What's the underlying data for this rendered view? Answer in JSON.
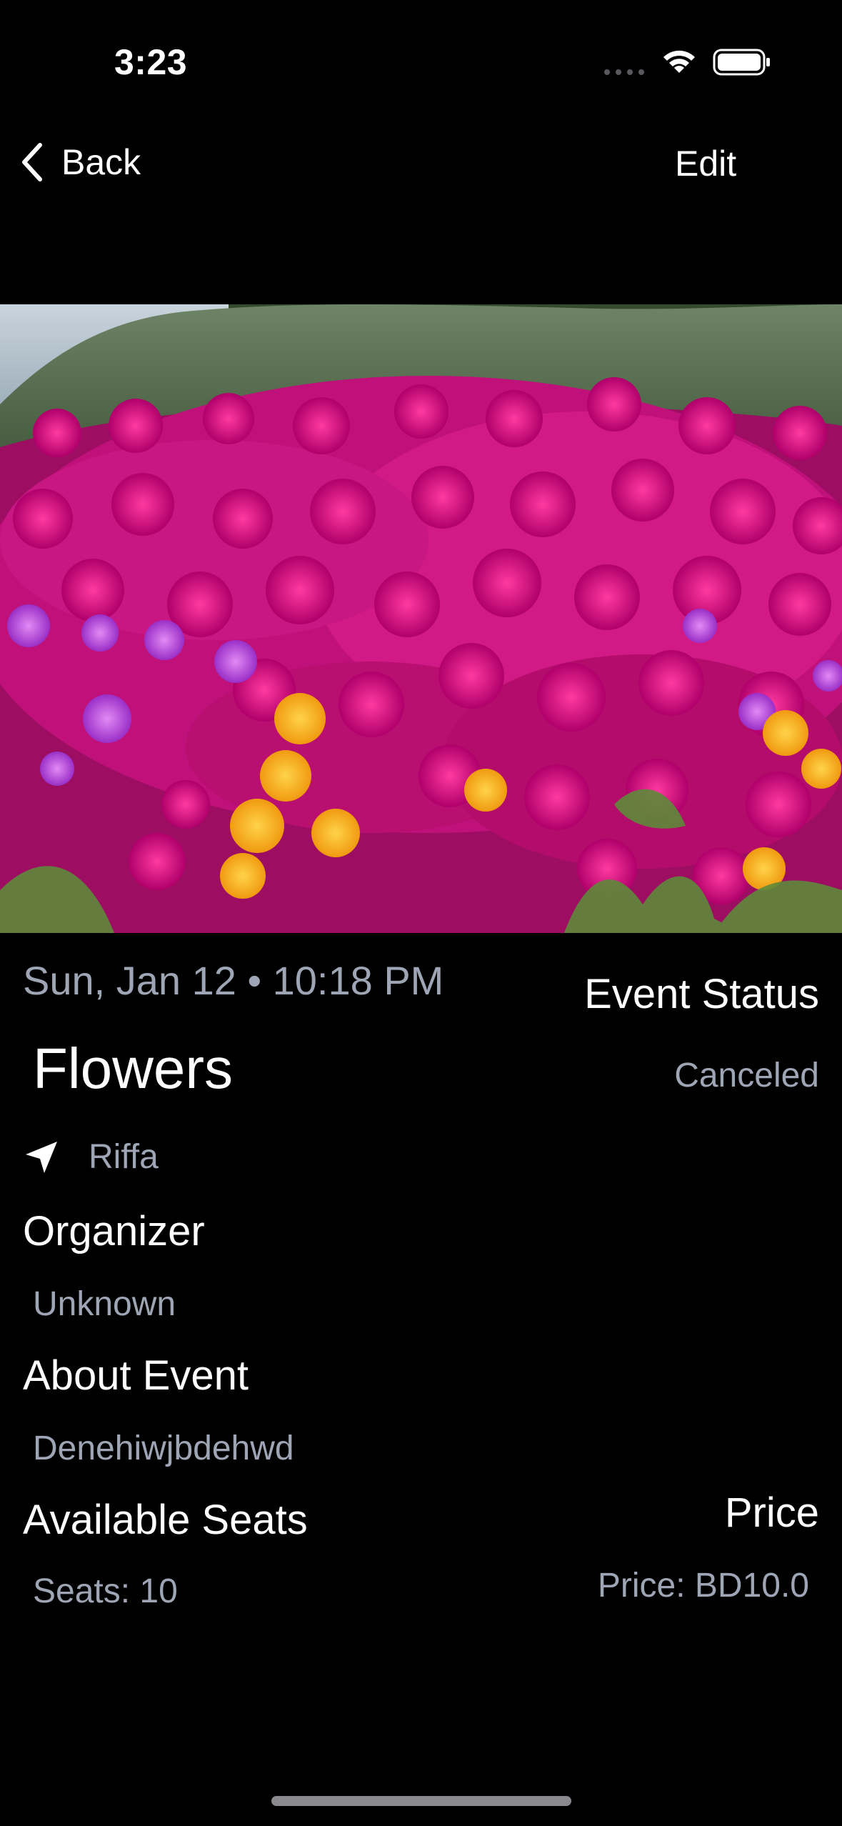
{
  "status_bar": {
    "time": "3:23"
  },
  "nav": {
    "back_label": "Back",
    "edit_label": "Edit"
  },
  "event": {
    "datetime": "Sun, Jan 12 • 10:18 PM",
    "title": "Flowers",
    "location": "Riffa",
    "status_title": "Event Status",
    "status_value": "Canceled",
    "organizer_title": "Organizer",
    "organizer_value": "Unknown",
    "about_title": "About Event",
    "about_value": "Denehiwjbdehwd",
    "seats_title": "Available Seats",
    "seats_value": "Seats: 10",
    "price_title": "Price",
    "price_value": "Price: BD10.0"
  },
  "icons": {
    "back": "chevron-left-icon",
    "location": "location-arrow-icon",
    "wifi": "wifi-icon",
    "battery": "battery-icon",
    "signal": "cellular-signal-icon"
  },
  "colors": {
    "background": "#000000",
    "primary_text": "#ffffff",
    "secondary_text": "#9ea5b5"
  }
}
